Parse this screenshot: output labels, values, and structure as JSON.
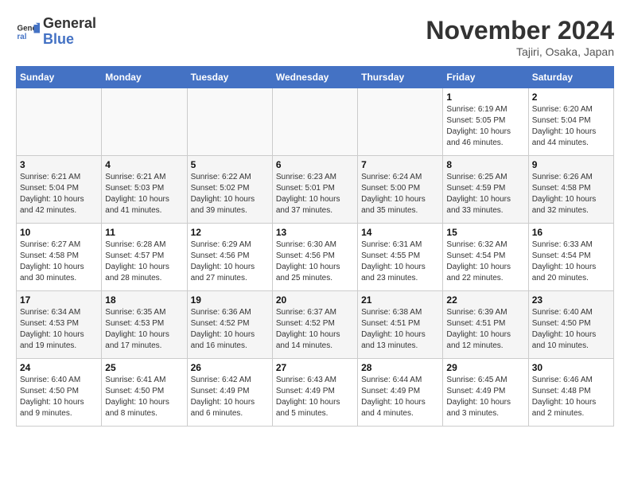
{
  "logo": {
    "general": "General",
    "blue": "Blue"
  },
  "header": {
    "month": "November 2024",
    "location": "Tajiri, Osaka, Japan"
  },
  "days_of_week": [
    "Sunday",
    "Monday",
    "Tuesday",
    "Wednesday",
    "Thursday",
    "Friday",
    "Saturday"
  ],
  "weeks": [
    [
      {
        "day": "",
        "info": ""
      },
      {
        "day": "",
        "info": ""
      },
      {
        "day": "",
        "info": ""
      },
      {
        "day": "",
        "info": ""
      },
      {
        "day": "",
        "info": ""
      },
      {
        "day": "1",
        "info": "Sunrise: 6:19 AM\nSunset: 5:05 PM\nDaylight: 10 hours and 46 minutes."
      },
      {
        "day": "2",
        "info": "Sunrise: 6:20 AM\nSunset: 5:04 PM\nDaylight: 10 hours and 44 minutes."
      }
    ],
    [
      {
        "day": "3",
        "info": "Sunrise: 6:21 AM\nSunset: 5:04 PM\nDaylight: 10 hours and 42 minutes."
      },
      {
        "day": "4",
        "info": "Sunrise: 6:21 AM\nSunset: 5:03 PM\nDaylight: 10 hours and 41 minutes."
      },
      {
        "day": "5",
        "info": "Sunrise: 6:22 AM\nSunset: 5:02 PM\nDaylight: 10 hours and 39 minutes."
      },
      {
        "day": "6",
        "info": "Sunrise: 6:23 AM\nSunset: 5:01 PM\nDaylight: 10 hours and 37 minutes."
      },
      {
        "day": "7",
        "info": "Sunrise: 6:24 AM\nSunset: 5:00 PM\nDaylight: 10 hours and 35 minutes."
      },
      {
        "day": "8",
        "info": "Sunrise: 6:25 AM\nSunset: 4:59 PM\nDaylight: 10 hours and 33 minutes."
      },
      {
        "day": "9",
        "info": "Sunrise: 6:26 AM\nSunset: 4:58 PM\nDaylight: 10 hours and 32 minutes."
      }
    ],
    [
      {
        "day": "10",
        "info": "Sunrise: 6:27 AM\nSunset: 4:58 PM\nDaylight: 10 hours and 30 minutes."
      },
      {
        "day": "11",
        "info": "Sunrise: 6:28 AM\nSunset: 4:57 PM\nDaylight: 10 hours and 28 minutes."
      },
      {
        "day": "12",
        "info": "Sunrise: 6:29 AM\nSunset: 4:56 PM\nDaylight: 10 hours and 27 minutes."
      },
      {
        "day": "13",
        "info": "Sunrise: 6:30 AM\nSunset: 4:56 PM\nDaylight: 10 hours and 25 minutes."
      },
      {
        "day": "14",
        "info": "Sunrise: 6:31 AM\nSunset: 4:55 PM\nDaylight: 10 hours and 23 minutes."
      },
      {
        "day": "15",
        "info": "Sunrise: 6:32 AM\nSunset: 4:54 PM\nDaylight: 10 hours and 22 minutes."
      },
      {
        "day": "16",
        "info": "Sunrise: 6:33 AM\nSunset: 4:54 PM\nDaylight: 10 hours and 20 minutes."
      }
    ],
    [
      {
        "day": "17",
        "info": "Sunrise: 6:34 AM\nSunset: 4:53 PM\nDaylight: 10 hours and 19 minutes."
      },
      {
        "day": "18",
        "info": "Sunrise: 6:35 AM\nSunset: 4:53 PM\nDaylight: 10 hours and 17 minutes."
      },
      {
        "day": "19",
        "info": "Sunrise: 6:36 AM\nSunset: 4:52 PM\nDaylight: 10 hours and 16 minutes."
      },
      {
        "day": "20",
        "info": "Sunrise: 6:37 AM\nSunset: 4:52 PM\nDaylight: 10 hours and 14 minutes."
      },
      {
        "day": "21",
        "info": "Sunrise: 6:38 AM\nSunset: 4:51 PM\nDaylight: 10 hours and 13 minutes."
      },
      {
        "day": "22",
        "info": "Sunrise: 6:39 AM\nSunset: 4:51 PM\nDaylight: 10 hours and 12 minutes."
      },
      {
        "day": "23",
        "info": "Sunrise: 6:40 AM\nSunset: 4:50 PM\nDaylight: 10 hours and 10 minutes."
      }
    ],
    [
      {
        "day": "24",
        "info": "Sunrise: 6:40 AM\nSunset: 4:50 PM\nDaylight: 10 hours and 9 minutes."
      },
      {
        "day": "25",
        "info": "Sunrise: 6:41 AM\nSunset: 4:50 PM\nDaylight: 10 hours and 8 minutes."
      },
      {
        "day": "26",
        "info": "Sunrise: 6:42 AM\nSunset: 4:49 PM\nDaylight: 10 hours and 6 minutes."
      },
      {
        "day": "27",
        "info": "Sunrise: 6:43 AM\nSunset: 4:49 PM\nDaylight: 10 hours and 5 minutes."
      },
      {
        "day": "28",
        "info": "Sunrise: 6:44 AM\nSunset: 4:49 PM\nDaylight: 10 hours and 4 minutes."
      },
      {
        "day": "29",
        "info": "Sunrise: 6:45 AM\nSunset: 4:49 PM\nDaylight: 10 hours and 3 minutes."
      },
      {
        "day": "30",
        "info": "Sunrise: 6:46 AM\nSunset: 4:48 PM\nDaylight: 10 hours and 2 minutes."
      }
    ]
  ]
}
